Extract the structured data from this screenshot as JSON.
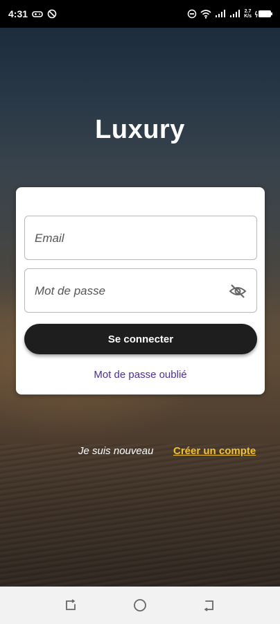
{
  "status_bar": {
    "time": "4:31",
    "net_speed_value": "2.7",
    "net_speed_unit": "K/s",
    "icons": [
      "gamepad-icon",
      "no-sync-icon",
      "do-not-disturb-icon",
      "wifi-icon",
      "signal-icon",
      "signal-icon",
      "battery-charging-icon"
    ]
  },
  "app": {
    "title": "Luxury"
  },
  "login": {
    "email_placeholder": "Email",
    "email_value": "",
    "password_placeholder": "Mot de passe",
    "password_value": "",
    "password_toggle_icon": "eye-off-icon",
    "submit_label": "Se connecter",
    "forgot_label": "Mot de passe oublié"
  },
  "signup": {
    "prompt": "Je suis nouveau",
    "link_label": "Créer un compte"
  },
  "nav_bar": {
    "buttons": [
      "recents-icon",
      "home-icon",
      "back-icon"
    ]
  },
  "colors": {
    "accent_link": "#4a2f9a",
    "signup_link": "#f2c230",
    "button_bg": "#1e1e1e"
  }
}
